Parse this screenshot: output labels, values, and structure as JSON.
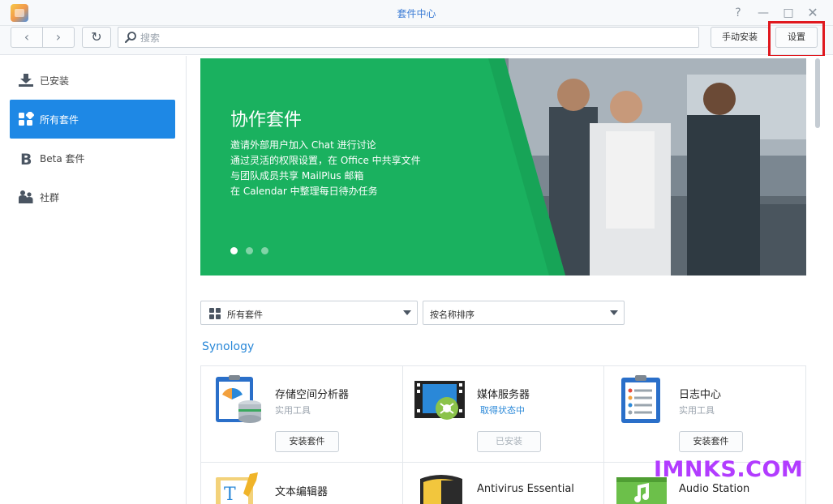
{
  "window": {
    "title": "套件中心",
    "controls": {
      "help": "?",
      "minimize": "—",
      "maximize": "□",
      "close": "✕"
    }
  },
  "toolbar": {
    "back": "‹",
    "forward": "›",
    "refresh": "↻",
    "search_placeholder": "搜索",
    "manual_install": "手动安装",
    "settings": "设置"
  },
  "sidebar": {
    "items": [
      {
        "label": "已安装",
        "icon": "download-icon"
      },
      {
        "label": "所有套件",
        "icon": "grid-icon",
        "active": true
      },
      {
        "label": "Beta 套件",
        "icon": "beta-icon"
      },
      {
        "label": "社群",
        "icon": "community-icon"
      }
    ]
  },
  "banner": {
    "title": "协作套件",
    "lines": [
      "邀请外部用户加入 Chat 进行讨论",
      "通过灵活的权限设置，在 Office 中共享文件",
      "与团队成员共享 MailPlus 邮箱",
      "在 Calendar 中整理每日待办任务"
    ],
    "active_slide": 1,
    "slide_count": 3,
    "accent": "#1ab15f"
  },
  "filters": {
    "category": "所有套件",
    "sort": "按名称排序"
  },
  "section": "Synology",
  "packages": [
    {
      "name": "存储空间分析器",
      "subtitle": "实用工具",
      "button": "安装套件",
      "icon": "storage-analyzer-icon"
    },
    {
      "name": "媒体服务器",
      "subtitle": "取得状态中",
      "button": "已安装",
      "icon": "media-server-icon"
    },
    {
      "name": "日志中心",
      "subtitle": "实用工具",
      "button": "安装套件",
      "icon": "log-center-icon"
    },
    {
      "name": "文本编辑器",
      "icon": "text-editor-icon"
    },
    {
      "name": "Antivirus Essential",
      "icon": "antivirus-icon"
    },
    {
      "name": "Audio Station",
      "icon": "audio-station-icon"
    }
  ],
  "watermark": "IMNKS.COM",
  "colors": {
    "primary": "#1e88e5",
    "highlight": "#e0181e",
    "link": "#2a88d8"
  }
}
